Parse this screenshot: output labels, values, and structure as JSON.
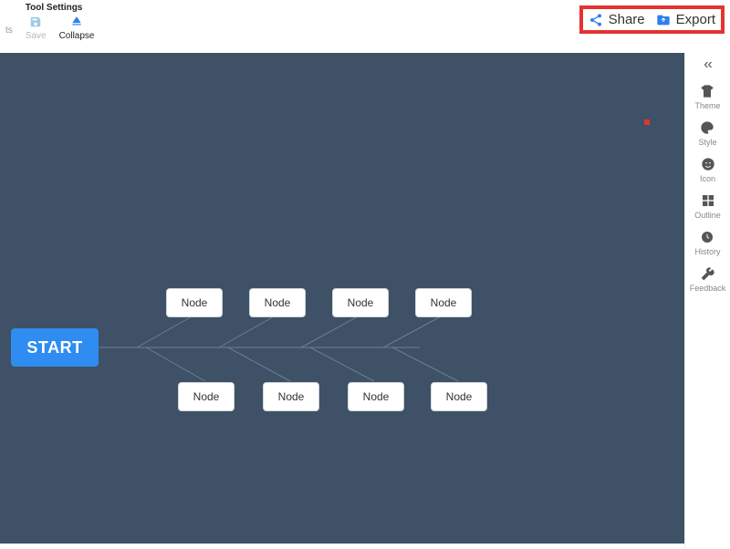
{
  "toolbar": {
    "cutoff_label": "ts",
    "group_title": "Tool Settings",
    "save_label": "Save",
    "collapse_label": "Collapse"
  },
  "actions": {
    "share_label": "Share",
    "export_label": "Export"
  },
  "sidebar": {
    "items": [
      {
        "label": "Theme"
      },
      {
        "label": "Style"
      },
      {
        "label": "Icon"
      },
      {
        "label": "Outline"
      },
      {
        "label": "History"
      },
      {
        "label": "Feedback"
      }
    ]
  },
  "diagram": {
    "root_label": "START",
    "top_nodes": [
      {
        "label": "Node"
      },
      {
        "label": "Node"
      },
      {
        "label": "Node"
      },
      {
        "label": "Node"
      }
    ],
    "bottom_nodes": [
      {
        "label": "Node"
      },
      {
        "label": "Node"
      },
      {
        "label": "Node"
      },
      {
        "label": "Node"
      }
    ]
  },
  "colors": {
    "canvas": "#3e5166",
    "accent": "#2f8cf0",
    "highlight_border": "#e3342f"
  }
}
